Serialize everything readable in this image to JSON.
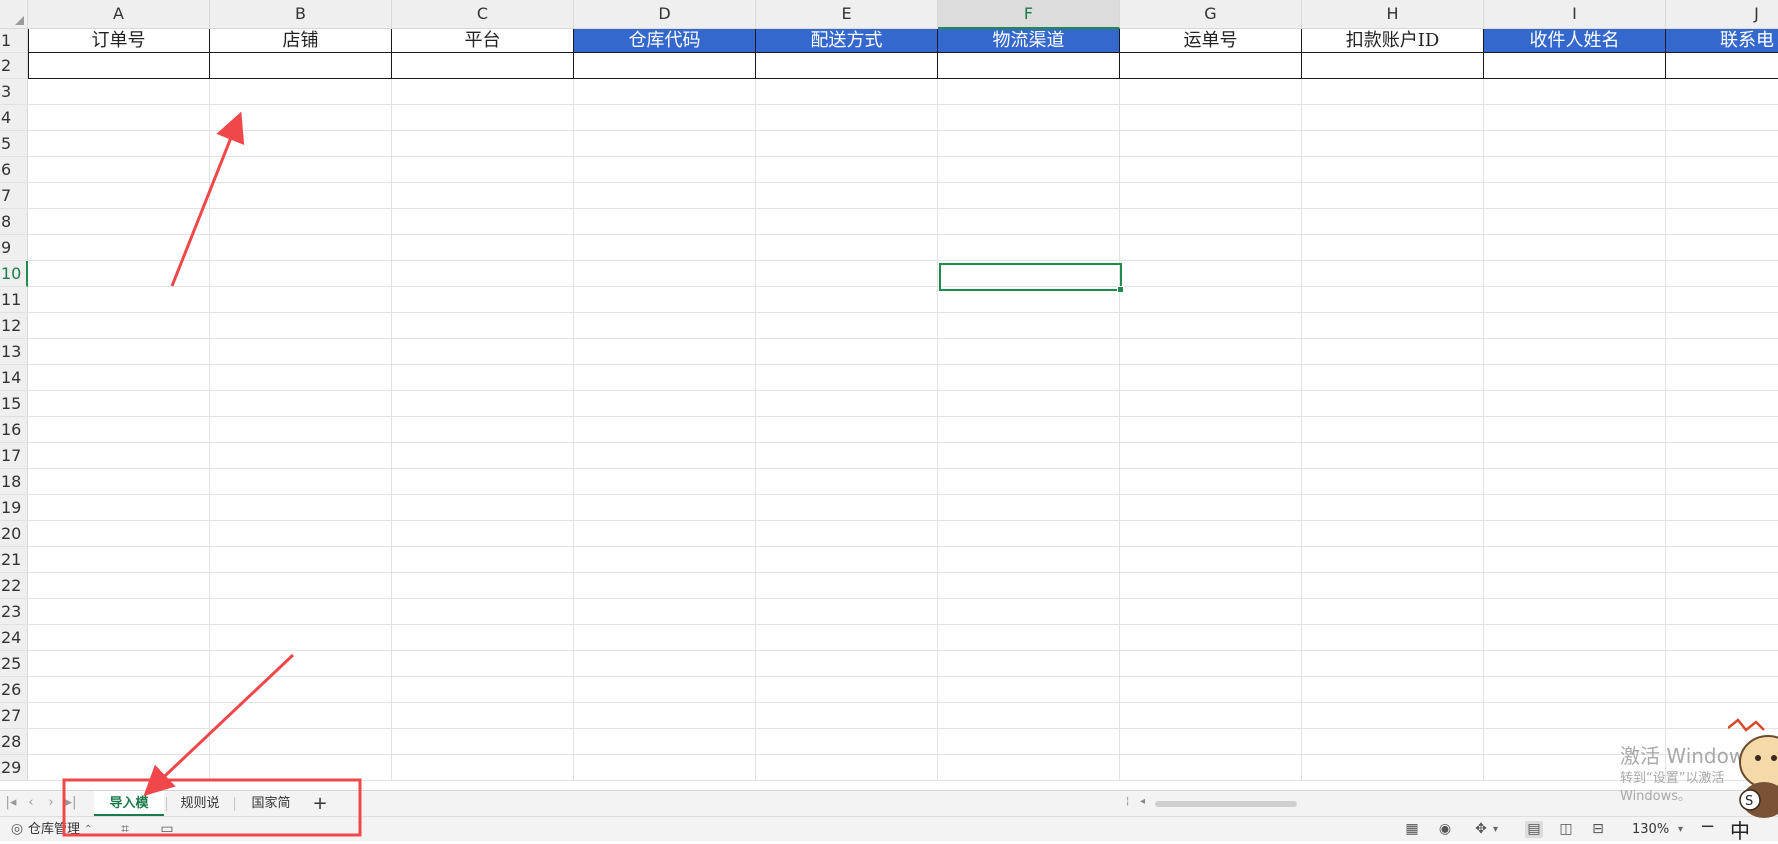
{
  "columns": [
    "A",
    "B",
    "C",
    "D",
    "E",
    "F",
    "G",
    "H",
    "I",
    "J"
  ],
  "selected_column": "F",
  "selected_row": 10,
  "rows": [
    1,
    2,
    3,
    4,
    5,
    6,
    7,
    8,
    9,
    10,
    11,
    12,
    13,
    14,
    15,
    16,
    17,
    18,
    19,
    20,
    21,
    22,
    23,
    24,
    25,
    26,
    27,
    28,
    29
  ],
  "header_row": [
    {
      "text": "订单号",
      "highlight": false
    },
    {
      "text": "店铺",
      "highlight": false
    },
    {
      "text": "平台",
      "highlight": false
    },
    {
      "text": "仓库代码",
      "highlight": true
    },
    {
      "text": "配送方式",
      "highlight": true
    },
    {
      "text": "物流渠道",
      "highlight": true
    },
    {
      "text": "运单号",
      "highlight": false
    },
    {
      "text": "扣款账户ID",
      "highlight": false
    },
    {
      "text": "收件人姓名",
      "highlight": true
    },
    {
      "text": "联系电",
      "highlight": true
    }
  ],
  "colors": {
    "highlight_bg": "#3468cc",
    "selection": "#1f8b4c",
    "annotation": "#f0484a"
  },
  "sheet_tabs": [
    {
      "label": "导入模板",
      "active": true
    },
    {
      "label": "规则说明",
      "active": false
    },
    {
      "label": "国家简码",
      "active": false
    }
  ],
  "add_sheet_label": "+",
  "status": {
    "workbook_label": "仓库管理",
    "zoom": "130%"
  },
  "watermark": {
    "title": "激活 Windows",
    "subtitle": "转到“设置”以激活 Windows。"
  },
  "ime_label": "中"
}
